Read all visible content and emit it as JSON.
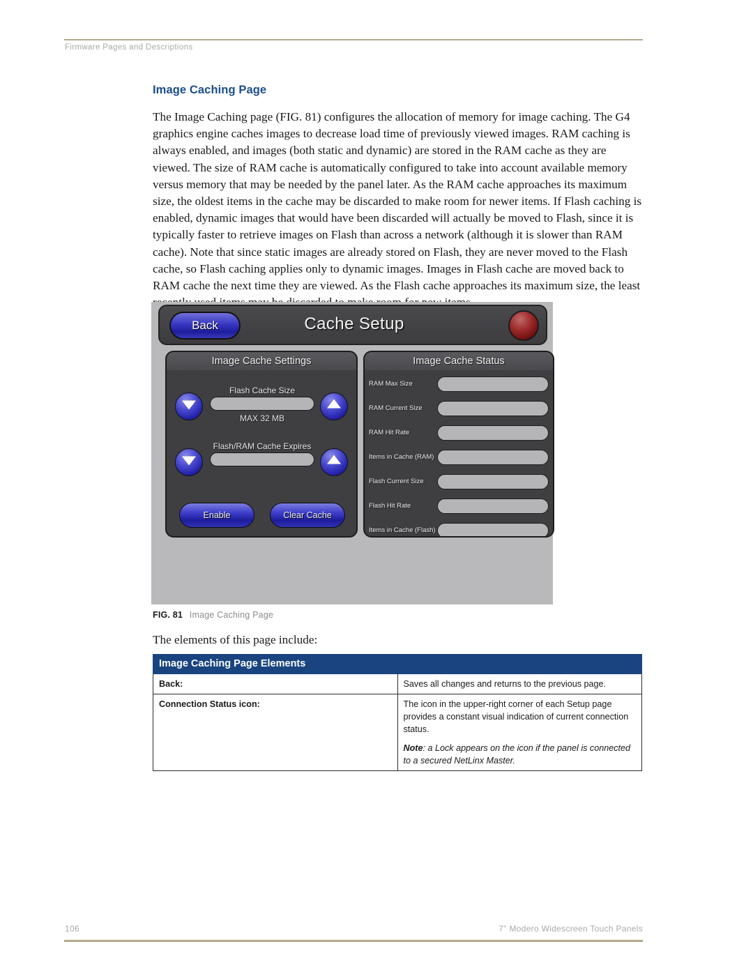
{
  "header": {
    "running_head": "Firmware Pages and Descriptions"
  },
  "section": {
    "heading": "Image Caching Page",
    "body": "The Image Caching page (FIG. 81) configures the allocation of memory for image caching. The G4 graphics engine caches images to decrease load time of previously viewed images. RAM caching is always enabled, and images (both static and dynamic) are stored in the RAM cache as they are viewed. The size of RAM cache is automatically configured to take into account available memory versus memory that may be needed by the panel later. As the RAM cache approaches its maximum size, the oldest items in the cache may be discarded to make room for newer items. If Flash caching is enabled, dynamic images that would have been discarded will actually be moved to Flash, since it is typically faster to retrieve images on Flash than across a network (although it is slower than RAM cache). Note that since static images are already stored on Flash, they are never moved to the Flash cache, so Flash caching applies only to dynamic images. Images in Flash cache are moved back to RAM cache the next time they are viewed. As the Flash cache approaches its maximum size, the least recently used items may be discarded to make room for new items.",
    "lead_in": "The elements of this page include:"
  },
  "figure": {
    "label": "FIG. 81",
    "caption": "Image Caching Page",
    "panel": {
      "back_button": "Back",
      "title": "Cache Setup",
      "status_led_color": "#8c1f1f",
      "settings_panel": {
        "title": "Image Cache Settings",
        "rows": [
          {
            "label": "Flash Cache Size",
            "value": "",
            "sub": "MAX  32 MB",
            "down_icon": "triangle-down-icon",
            "up_icon": "triangle-up-icon"
          },
          {
            "label": "Flash/RAM Cache Expires",
            "value": "",
            "sub": "",
            "down_icon": "triangle-down-icon",
            "up_icon": "triangle-up-icon"
          }
        ],
        "buttons": [
          {
            "label": "Enable"
          },
          {
            "label": "Clear Cache"
          }
        ]
      },
      "status_panel": {
        "title": "Image Cache Status",
        "rows": [
          {
            "label": "RAM Max Size",
            "value": ""
          },
          {
            "label": "RAM Current Size",
            "value": ""
          },
          {
            "label": "RAM Hit Rate",
            "value": ""
          },
          {
            "label": "Items in Cache (RAM)",
            "value": ""
          },
          {
            "label": "Flash Current Size",
            "value": ""
          },
          {
            "label": "Flash Hit Rate",
            "value": ""
          },
          {
            "label": "Items in Cache (Flash)",
            "value": ""
          }
        ]
      }
    }
  },
  "table": {
    "title": "Image Caching Page Elements",
    "rows": [
      {
        "term": "Back:",
        "desc": "Saves all changes and returns to the previous page.",
        "note_label": "",
        "note": ""
      },
      {
        "term": "Connection Status icon:",
        "desc": "The icon in the upper-right corner of each Setup page provides a constant visual indication of current connection status.",
        "note_label": "Note",
        "note": ": a Lock appears on the icon if the panel is connected to a secured NetLinx Master."
      }
    ]
  },
  "footer": {
    "page_number": "106",
    "document_title": "7\" Modero Widescreen Touch Panels"
  },
  "colors": {
    "rule": "#b3a98c",
    "heading": "#1b4d8e",
    "table_header": "#1a4480",
    "panel_bg": "#b9b9bb"
  }
}
